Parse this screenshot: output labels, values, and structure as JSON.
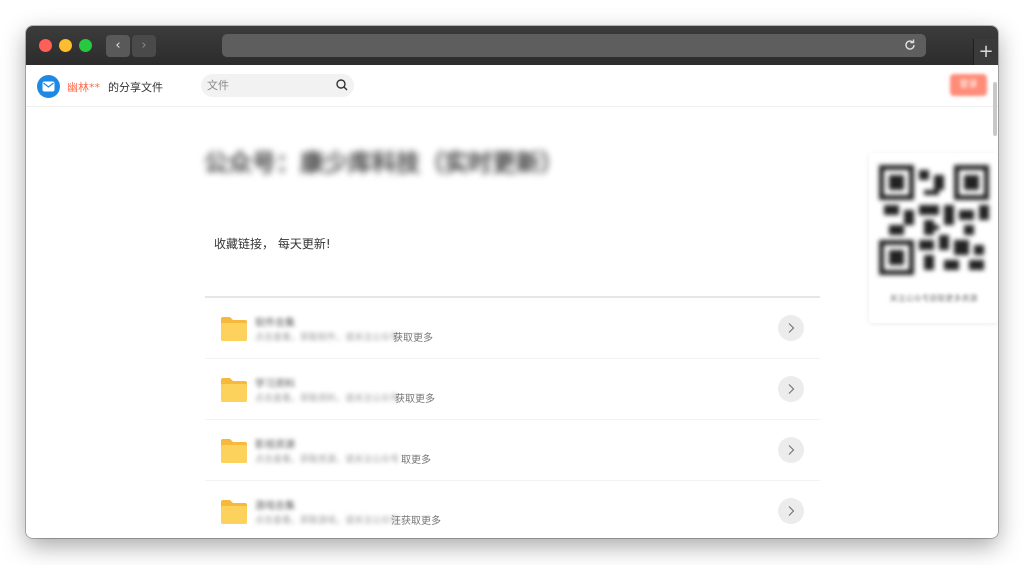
{
  "browser": {
    "back_label": "‹",
    "forward_label": "›",
    "new_tab_label": "+"
  },
  "header": {
    "user_name": "幽林**",
    "title_suffix": "的分享文件",
    "search_placeholder": "文件",
    "login_label": "登录"
  },
  "main": {
    "title": "公众号：康少库科技（实时更新）",
    "subtitle": "收藏链接， 每天更新!"
  },
  "qr_card": {
    "caption": "关注公众号获取更多资源"
  },
  "files": [
    {
      "name": "软件合集",
      "desc_blur": "点击查看，获取软件，请关注公众号",
      "desc_clear": "获取更多"
    },
    {
      "name": "学习资料",
      "desc_blur": "点击查看，获取资料，请关注公众号",
      "desc_clear": "获取更多"
    },
    {
      "name": "影视资源",
      "desc_blur": "点击查看，获取资源，请关注公众号",
      "desc_clear": "取更多"
    },
    {
      "name": "游戏合集",
      "desc_blur": "点击查看，获取游戏，请关注公众号",
      "desc_clear": "汪获取更多"
    }
  ],
  "colors": {
    "accent": "#ff6b4a",
    "logo": "#1e88e5",
    "folder": "#f6b93b"
  }
}
